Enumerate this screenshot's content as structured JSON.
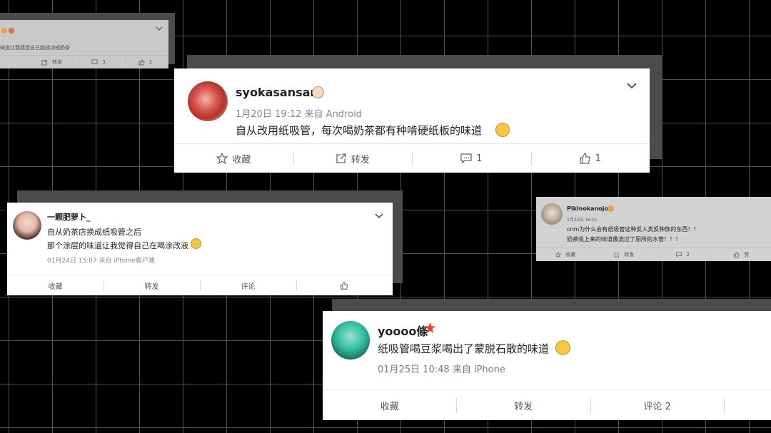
{
  "colors": {
    "background": "#000000",
    "grid": "#5a5a5a",
    "card": "#ffffff",
    "meta": "#888888",
    "star": "#e8412c"
  },
  "post_top_left": {
    "text": "味道让我感觉自己能成功戒奶茶",
    "actions": {
      "share": "转发",
      "comment": "3",
      "like": "2"
    }
  },
  "post_main": {
    "username": "syokasansan",
    "meta": "1月20日 19:12 来自 Android",
    "text": "自从改用纸吸管，每次喝奶茶都有种啃硬纸板的味道",
    "actions": {
      "favorite": "收藏",
      "share": "转发",
      "comment": "1",
      "like": "1"
    }
  },
  "post_left": {
    "username": "一颗肥萝卜_",
    "line1": "自从奶茶店换成纸吸管之后",
    "line2": "那个涂层的味道让我觉得自己在喝涂改液",
    "meta": "01月24日 15:07  来自 iPhone客户端",
    "actions": {
      "favorite": "收藏",
      "share": "转发",
      "comment": "评论"
    }
  },
  "post_right": {
    "username": "Pikinokanojo",
    "meta": "1月22日 16:01",
    "line1": "cnm为什么会有纸吸管这种反人类反种族的东西！！",
    "line2": "奶茶吸上来的味道像流过了厕所的水管！！！",
    "actions": {
      "favorite": "收藏",
      "share": "转发",
      "comment": "2",
      "like": "赞"
    }
  },
  "post_bottom": {
    "username": "yoooo條",
    "text": "纸吸管喝豆浆喝出了蒙脱石散的味道",
    "meta": "01月25日 10:48  来自 iPhone",
    "actions": {
      "favorite": "收藏",
      "share": "转发",
      "comment": "评论 2"
    }
  }
}
